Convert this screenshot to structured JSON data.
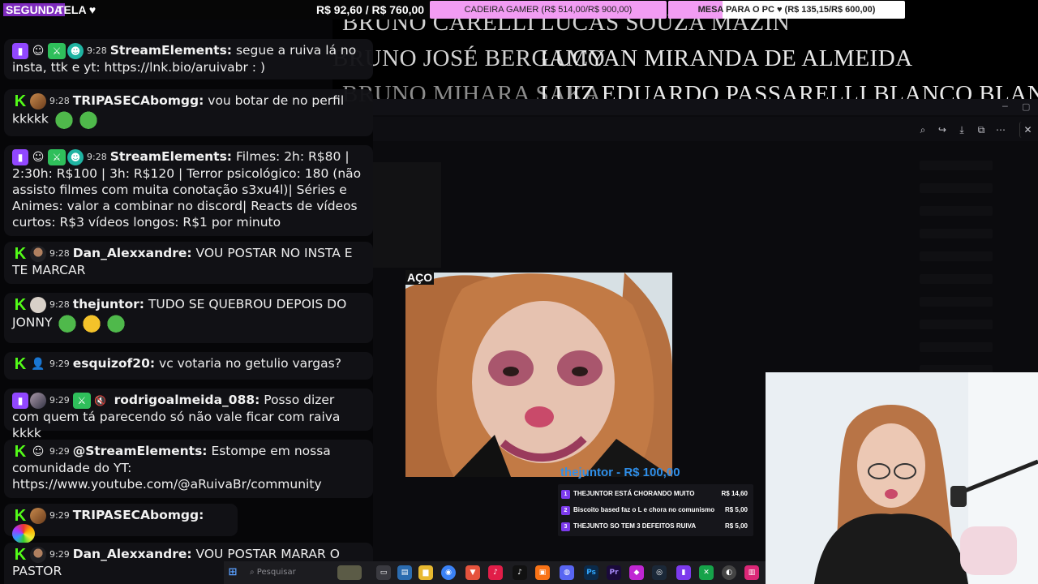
{
  "ticker": {
    "label_part1": "SEGUNDA",
    "label_part2": "TELA ♥",
    "value": "R$ 92,60 / R$ 760,00"
  },
  "goals": [
    {
      "text": "CADEIRA GAMER (R$ 514,00/R$ 900,00)",
      "progress": 0.57
    },
    {
      "text": "MESA PARA O PC ♥ (R$ 135,15/R$ 600,00)",
      "progress": 0.23
    }
  ],
  "credits": [
    "BRUNO CARELLI",
    "LUCAS SOUZA MAZIN",
    "BRUNO JOSÉ BERGAMO",
    "LUCYAN MIRANDA DE ALMEIDA",
    "BRUNO MIHARA SAKAI",
    "LUIZ EDUARDO PASSARELLI BLANCO BLANCO"
  ],
  "chat": [
    {
      "time": "9:28",
      "user": "StreamElements:",
      "text": "segue a ruiva lá no insta, ttk e yt: https://lnk.bio/aruivabr : )"
    },
    {
      "time": "9:28",
      "user": "TRIPASECAbomgg:",
      "text": "vou botar de no perfil kkkkk"
    },
    {
      "time": "9:28",
      "user": "StreamElements:",
      "text": "Filmes: 2h: R$80 | 2:30h: R$100 | 3h: R$120 | Terror psicológico: 180 (não assisto filmes com muita conotação s3xu4l)| Séries e Animes: valor a combinar no discord| Reacts de vídeos curtos: R$3 vídeos longos: R$1 por minuto"
    },
    {
      "time": "9:28",
      "user": "Dan_Alexxandre:",
      "text": "VOU POSTAR NO INSTA E TE MARCAR"
    },
    {
      "time": "9:28",
      "user": "thejuntor:",
      "text": "TUDO SE QUEBROU DEPOIS DO JONNY"
    },
    {
      "time": "9:29",
      "user": "esquizof20:",
      "text": "vc votaria no getulio vargas?"
    },
    {
      "time": "9:29",
      "user": "rodrigoalmeida_088:",
      "text": "Posso dizer com quem tá parecendo só não vale ficar com raiva kkkk"
    },
    {
      "time": "9:29",
      "user": "@StreamElements:",
      "text": "Estompe em nossa comunidade do YT: https://www.youtube.com/@aRuivaBr/community"
    },
    {
      "time": "9:29",
      "user": "TRIPASECAbomgg:",
      "text": ""
    },
    {
      "time": "9:29",
      "user": "Dan_Alexxandre:",
      "text": "VOU POSTAR MARAR O PASTOR"
    }
  ],
  "clip_tag": "AÇO",
  "donation": {
    "title": "thejuntor - R$ 100,00",
    "items": [
      {
        "n": "1",
        "text": "THEJUNTOR ESTÁ CHORANDO MUITO",
        "amount": "R$ 14,60"
      },
      {
        "n": "2",
        "text": "Biscoito based faz o L e chora no comunismo",
        "amount": "R$ 5,00"
      },
      {
        "n": "3",
        "text": "THEJUNTO SO TEM 3 DEFEITOS RUIVA",
        "amount": "R$ 5,00"
      }
    ]
  },
  "taskbar": {
    "search_placeholder": "Pesquisar"
  },
  "colors": {
    "twitch": "#9147ff",
    "kick": "#53fc18",
    "goal_fill": "#f29cf3",
    "donation_title": "#2f8ee8",
    "ticker_label": "#7e2bbd"
  }
}
